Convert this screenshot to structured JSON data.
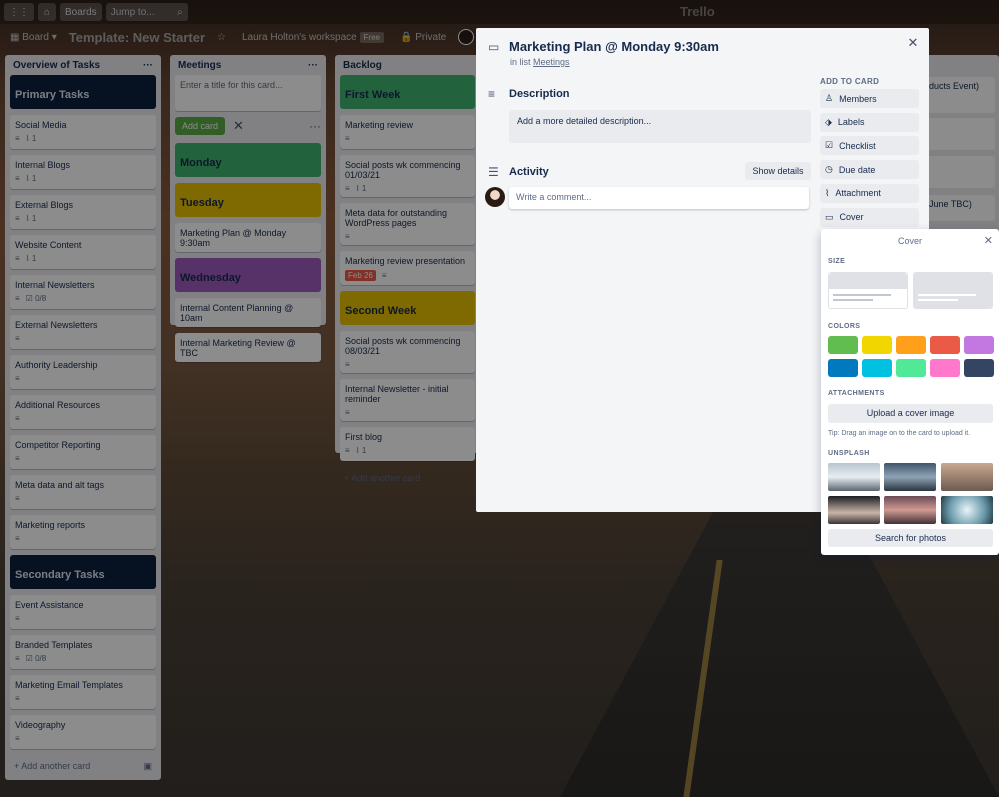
{
  "topbar": {
    "boards": "Boards",
    "search_placeholder": "Jump to...",
    "logo": "Trello"
  },
  "boardbar": {
    "board": "Board",
    "title": "Template: New Starter",
    "workspace": "Laura Holton's workspace",
    "free": "Free",
    "private": "Private"
  },
  "lists": {
    "overview": {
      "title": "Overview of Tasks",
      "add": "Add another card",
      "cards": [
        {
          "type": "section",
          "label": "Primary Tasks",
          "color": "#0b1f3d"
        },
        {
          "label": "Social Media",
          "attach": "1"
        },
        {
          "label": "Internal Blogs",
          "attach": "1"
        },
        {
          "label": "External Blogs",
          "attach": "1"
        },
        {
          "label": "Website Content",
          "attach": "1"
        },
        {
          "label": "Internal Newsletters",
          "check": "0/8"
        },
        {
          "label": "External Newsletters"
        },
        {
          "label": "Authority Leadership"
        },
        {
          "label": "Additional Resources"
        },
        {
          "label": "Competitor Reporting"
        },
        {
          "label": "Meta data and alt tags"
        },
        {
          "label": "Marketing reports"
        },
        {
          "type": "section",
          "label": "Secondary Tasks",
          "color": "#0b1f3d"
        },
        {
          "label": "Event Assistance"
        },
        {
          "label": "Branded Templates",
          "check": "0/8"
        },
        {
          "label": "Marketing Email Templates"
        },
        {
          "label": "Videography"
        }
      ]
    },
    "meetings": {
      "title": "Meetings",
      "input_placeholder": "Enter a title for this card...",
      "add_button": "Add card",
      "cards": [
        {
          "type": "section",
          "label": "Monday",
          "color": "#3fb56f"
        },
        {
          "type": "section",
          "label": "Tuesday",
          "color": "#e6c200"
        },
        {
          "label": "Marketing Plan @ Monday 9:30am"
        },
        {
          "type": "section",
          "label": "Wednesday",
          "color": "#9e5bbd"
        },
        {
          "label": "Internal Content Planning @ 10am"
        },
        {
          "label": "Internal Marketing Review @ TBC"
        }
      ]
    },
    "backlog": {
      "title": "Backlog",
      "add": "Add another card",
      "cards": [
        {
          "type": "section",
          "label": "First Week",
          "color": "#3fb56f"
        },
        {
          "label": "Marketing review"
        },
        {
          "label": "Social posts wk commencing 01/03/21",
          "attach": "1"
        },
        {
          "label": "Meta data for outstanding WordPress pages"
        },
        {
          "label": "Marketing review presentation",
          "due": "Feb 26"
        },
        {
          "type": "section",
          "label": "Second Week",
          "color": "#e6c200"
        },
        {
          "label": "Social posts wk commencing 08/03/21"
        },
        {
          "label": "Internal Newsletter - initial reminder"
        },
        {
          "label": "First blog",
          "attach": "1"
        }
      ]
    },
    "right": {
      "cards": [
        {
          "label": "ducts Event)"
        },
        {
          "label": "June TBC)"
        }
      ]
    }
  },
  "modal": {
    "title": "Marketing Plan @ Monday 9:30am",
    "in_list_prefix": "in list",
    "list_name": "Meetings",
    "description_h": "Description",
    "description_placeholder": "Add a more detailed description...",
    "activity_h": "Activity",
    "show_details": "Show details",
    "comment_placeholder": "Write a comment...",
    "add_to_card": "ADD TO CARD",
    "side": [
      {
        "label": "Members",
        "icon": "person-icon"
      },
      {
        "label": "Labels",
        "icon": "label-icon"
      },
      {
        "label": "Checklist",
        "icon": "checklist-icon"
      },
      {
        "label": "Due date",
        "icon": "clock-icon"
      },
      {
        "label": "Attachment",
        "icon": "paperclip-icon"
      },
      {
        "label": "Cover",
        "icon": "cover-icon"
      }
    ]
  },
  "cover_popover": {
    "title": "Cover",
    "size_h": "SIZE",
    "colors_h": "COLORS",
    "colors": [
      "#61bd4f",
      "#f2d600",
      "#ff9f1a",
      "#eb5a46",
      "#c377e0",
      "#0079bf",
      "#00c2e0",
      "#51e898",
      "#ff78cb",
      "#344563"
    ],
    "attachments_h": "ATTACHMENTS",
    "upload": "Upload a cover image",
    "tip": "Tip: Drag an image on to the card to upload it.",
    "unsplash_h": "UNSPLASH",
    "search": "Search for photos"
  }
}
